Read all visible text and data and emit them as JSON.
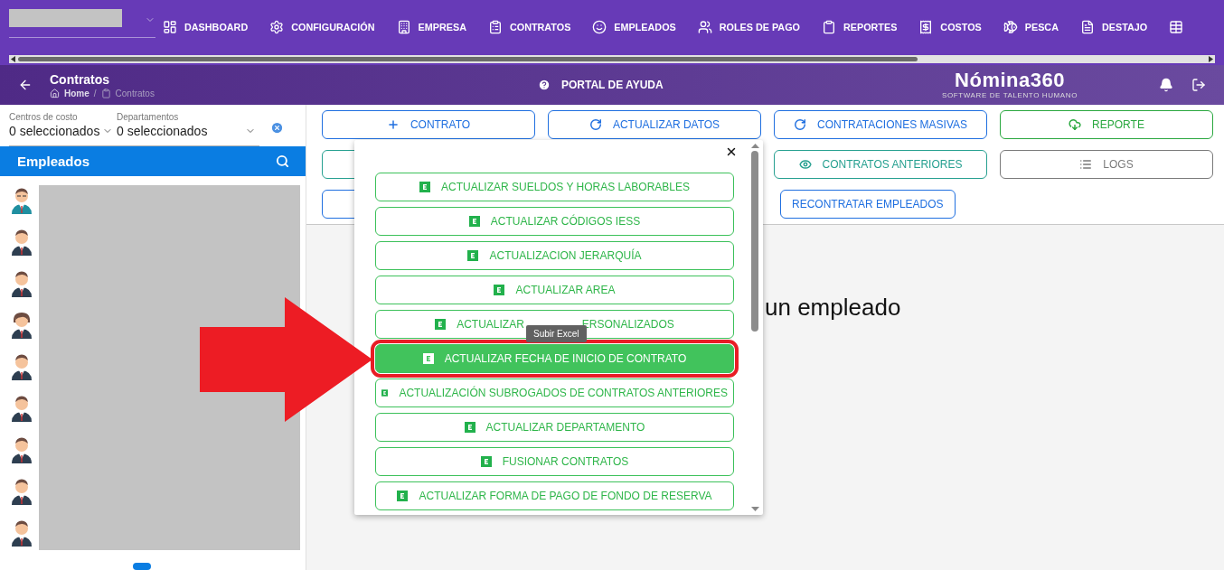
{
  "top_nav": {
    "company_select": {
      "redacted": true
    },
    "items": [
      {
        "kind": "link",
        "label": "DASHBOARD"
      },
      {
        "kind": "link",
        "label": "CONFIGURACIÓN"
      },
      {
        "kind": "link",
        "label": "EMPRESA"
      },
      {
        "kind": "link",
        "label": "CONTRATOS"
      },
      {
        "kind": "link",
        "label": "EMPLEADOS"
      },
      {
        "kind": "link",
        "label": "ROLES DE PAGO"
      },
      {
        "kind": "link",
        "label": "REPORTES"
      },
      {
        "kind": "link",
        "label": "COSTOS"
      },
      {
        "kind": "link",
        "label": "PESCA"
      },
      {
        "kind": "link",
        "label": "DESTAJO"
      },
      {
        "kind": "icon-only"
      }
    ]
  },
  "header": {
    "title": "Contratos",
    "breadcrumb": [
      "Home",
      "Contratos"
    ],
    "breadcrumb_separator": "/",
    "help": "PORTAL DE AYUDA",
    "logo": {
      "name": "Nómina360",
      "tagline": "SOFTWARE DE TALENTO HUMANO"
    }
  },
  "sidebar": {
    "filters": [
      {
        "label": "Centros de costo",
        "value": "0 seleccionados"
      },
      {
        "label": "Departamentos",
        "value": "0 seleccionados"
      }
    ],
    "panel_title": "Empleados",
    "employees": [
      {
        "kind": "man-teal"
      },
      {
        "kind": "man"
      },
      {
        "kind": "man"
      },
      {
        "kind": "woman"
      },
      {
        "kind": "man"
      },
      {
        "kind": "man"
      },
      {
        "kind": "man"
      },
      {
        "kind": "man"
      },
      {
        "kind": "man"
      }
    ]
  },
  "actions": [
    [
      {
        "label": "CONTRATO",
        "color": "#1f6fe0"
      },
      {
        "label": "ACTUALIZAR DATOS",
        "color": "#1f6fe0"
      },
      {
        "label": "CONTRATACIONES MASIVAS",
        "color": "#1f6fe0"
      },
      {
        "label": "REPORTE",
        "color": "#2aa83f"
      }
    ],
    [
      {
        "color": "#26a090"
      },
      {
        "label": "CONTRATOS ANTERIORES",
        "color": "#26a090"
      },
      {
        "label": "LOGS",
        "color": "#7a7a7a"
      }
    ],
    [
      {
        "color": "#1f6fe0"
      },
      {
        "label": "RECONTRATAR EMPLEADOS",
        "color": "#1f6fe0",
        "compact": true
      }
    ]
  ],
  "content": {
    "message": "un empleado"
  },
  "popup": {
    "tooltip": "Subir Excel",
    "items": [
      {
        "label": "ACTUALIZAR SUELDOS Y HORAS LABORABLES",
        "selected": false,
        "outlined": false
      },
      {
        "label": "ACTUALIZAR CÓDIGOS IESS",
        "selected": false,
        "outlined": false
      },
      {
        "label": "ACTUALIZACION JERARQUÍA",
        "selected": false,
        "outlined": false
      },
      {
        "label": "ACTUALIZAR AREA",
        "selected": false,
        "outlined": false
      },
      {
        "label": "ACTUALIZAR",
        "label_after": "ERSONALIZADOS",
        "selected": false,
        "outlined": false
      },
      {
        "label": "ACTUALIZAR FECHA DE INICIO DE CONTRATO",
        "selected": true,
        "outlined": true
      },
      {
        "label": "ACTUALIZACIÓN SUBROGADOS DE CONTRATOS ANTERIORES",
        "selected": false,
        "outlined": false
      },
      {
        "label": "ACTUALIZAR DEPARTAMENTO",
        "selected": false,
        "outlined": false
      },
      {
        "label": "FUSIONAR CONTRATOS",
        "selected": false,
        "outlined": false
      },
      {
        "label": "ACTUALIZAR FORMA DE PAGO DE FONDO DE RESERVA",
        "selected": false,
        "outlined": false
      }
    ]
  },
  "annotation": {
    "arrow": true
  }
}
